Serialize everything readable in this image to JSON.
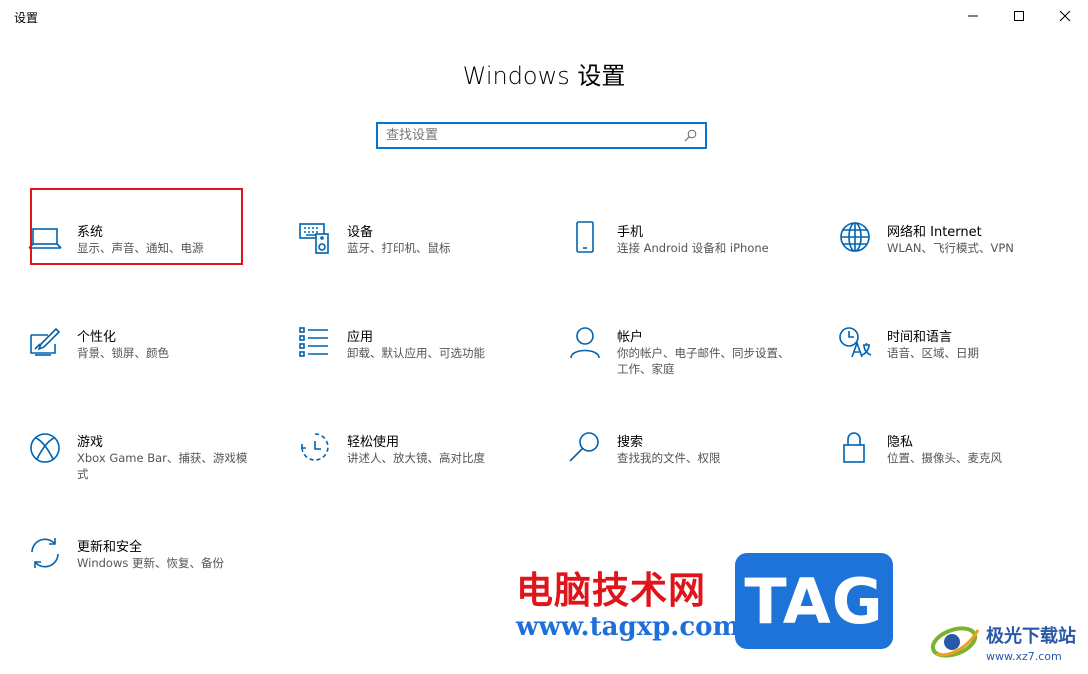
{
  "window": {
    "title": "设置",
    "controls": {
      "minimize": "minimize-icon",
      "maximize": "maximize-icon",
      "close": "close-icon"
    }
  },
  "page": {
    "heading": "Windows 设置"
  },
  "search": {
    "placeholder": "查找设置",
    "value": "",
    "icon": "search-icon"
  },
  "categories": [
    {
      "icon": "laptop-icon",
      "title": "系统",
      "description": "显示、声音、通知、电源"
    },
    {
      "icon": "keyboard-speaker-icon",
      "title": "设备",
      "description": "蓝牙、打印机、鼠标"
    },
    {
      "icon": "phone-icon",
      "title": "手机",
      "description": "连接 Android 设备和 iPhone"
    },
    {
      "icon": "globe-icon",
      "title": "网络和 Internet",
      "description": "WLAN、飞行模式、VPN"
    },
    {
      "icon": "paint-pen-icon",
      "title": "个性化",
      "description": "背景、锁屏、颜色"
    },
    {
      "icon": "app-list-icon",
      "title": "应用",
      "description": "卸载、默认应用、可选功能"
    },
    {
      "icon": "person-icon",
      "title": "帐户",
      "description": "你的帐户、电子邮件、同步设置、工作、家庭"
    },
    {
      "icon": "time-language-icon",
      "title": "时间和语言",
      "description": "语音、区域、日期"
    },
    {
      "icon": "xbox-icon",
      "title": "游戏",
      "description": "Xbox Game Bar、捕获、游戏模式"
    },
    {
      "icon": "ease-of-access-icon",
      "title": "轻松使用",
      "description": "讲述人、放大镜、高对比度"
    },
    {
      "icon": "search-icon",
      "title": "搜索",
      "description": "查找我的文件、权限"
    },
    {
      "icon": "lock-icon",
      "title": "隐私",
      "description": "位置、摄像头、麦克风"
    },
    {
      "icon": "sync-icon",
      "title": "更新和安全",
      "description": "Windows 更新、恢复、备份"
    }
  ],
  "watermark": {
    "site_cn": "电脑技术网",
    "site_url": "www.tagxp.com",
    "tag": "TAG",
    "xz_cn": "极光下载站",
    "xz_url": "www.xz7.com"
  },
  "colors": {
    "accent": "#0078d7",
    "highlight": "#e0151c"
  }
}
